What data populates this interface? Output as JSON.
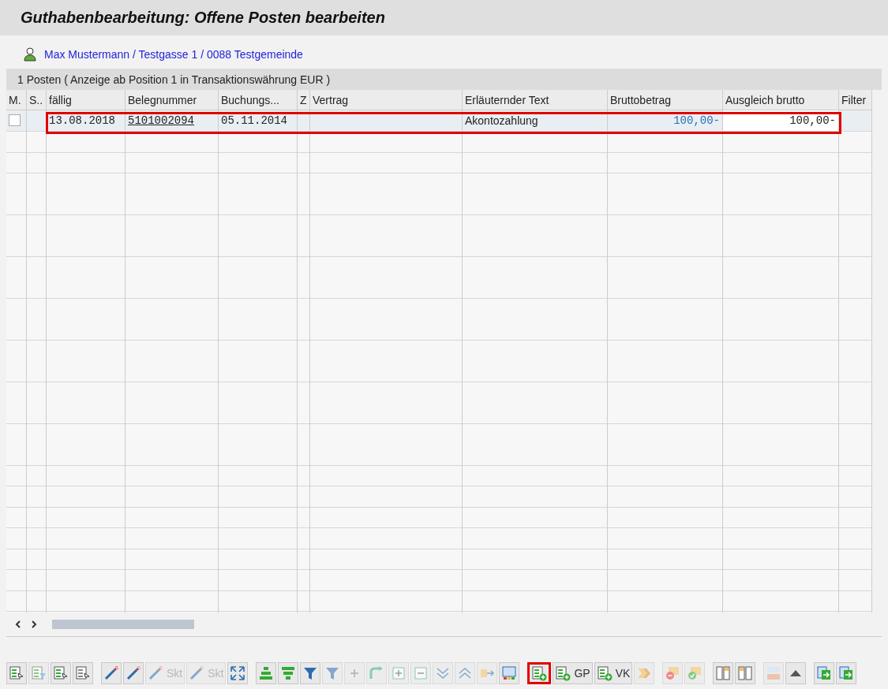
{
  "window": {
    "title": "Guthabenbearbeitung: Offene Posten bearbeiten"
  },
  "partner": {
    "text": "Max Mustermann / Testgasse 1 / 0088 Testgemeinde"
  },
  "info_bar": "1 Posten ( Anzeige ab Position 1 in Transaktionswährung EUR )",
  "table": {
    "columns": [
      "M.",
      "S..",
      "fällig",
      "Belegnummer",
      "Buchungs...",
      "Z",
      "Vertrag",
      "Erläuternder Text",
      "Bruttobetrag",
      "Ausgleich brutto",
      "Filter"
    ],
    "rows": [
      {
        "checked": false,
        "highlighted": true,
        "faellig": "13.08.2018",
        "belegnummer": "5101002094",
        "buchung": "05.11.2014",
        "text": "Akontozahlung",
        "brutto": "100,00-",
        "ausgleich": "100,00-"
      }
    ]
  },
  "toolbar": [
    {
      "group": [
        {
          "kind": "select",
          "disabled": false,
          "highlighted": false
        },
        {
          "kind": "listfilter",
          "disabled": true,
          "highlighted": false
        },
        {
          "kind": "select",
          "disabled": false,
          "highlighted": false
        },
        {
          "kind": "plain",
          "disabled": false,
          "highlighted": false
        }
      ]
    },
    {
      "group": [
        {
          "kind": "wand",
          "disabled": false,
          "highlighted": false
        },
        {
          "kind": "wanddark",
          "disabled": false,
          "highlighted": false
        },
        {
          "kind": "wand",
          "label": "Skt",
          "disabled": true,
          "highlighted": false
        },
        {
          "kind": "wanddark",
          "label": "Skt",
          "disabled": true,
          "highlighted": false
        },
        {
          "kind": "expand",
          "disabled": false,
          "highlighted": false
        }
      ]
    },
    {
      "group": [
        {
          "kind": "sum",
          "disabled": false,
          "highlighted": false
        },
        {
          "kind": "subtotal",
          "disabled": false,
          "highlighted": false
        },
        {
          "kind": "filter",
          "disabled": false,
          "highlighted": false
        },
        {
          "kind": "filter",
          "disabled": true,
          "highlighted": false
        },
        {
          "kind": "plus",
          "disabled": true,
          "highlighted": false
        },
        {
          "kind": "tree",
          "disabled": true,
          "highlighted": false
        },
        {
          "kind": "expandnode",
          "disabled": true,
          "highlighted": false
        },
        {
          "kind": "collapsenode",
          "disabled": true,
          "highlighted": false
        },
        {
          "kind": "down",
          "disabled": true,
          "highlighted": false
        },
        {
          "kind": "up",
          "disabled": true,
          "highlighted": false
        },
        {
          "kind": "export",
          "disabled": true,
          "highlighted": false
        },
        {
          "kind": "layout",
          "disabled": false,
          "highlighted": false
        }
      ]
    },
    {
      "group": [
        {
          "kind": "addrow",
          "disabled": false,
          "highlighted": true
        },
        {
          "kind": "addrow",
          "label": "GP",
          "disabled": false,
          "highlighted": false
        },
        {
          "kind": "addrow",
          "label": "VK",
          "disabled": false,
          "highlighted": false
        },
        {
          "kind": "swap",
          "disabled": true,
          "highlighted": false
        }
      ]
    },
    {
      "group": [
        {
          "kind": "remove",
          "disabled": true,
          "highlighted": false
        },
        {
          "kind": "confirm",
          "disabled": true,
          "highlighted": false
        }
      ]
    },
    {
      "group": [
        {
          "kind": "colleft",
          "disabled": false,
          "highlighted": false
        },
        {
          "kind": "colright",
          "disabled": false,
          "highlighted": false
        }
      ]
    },
    {
      "group": [
        {
          "kind": "currency",
          "disabled": true,
          "highlighted": false
        },
        {
          "kind": "triangle",
          "disabled": false,
          "highlighted": false
        }
      ]
    },
    {
      "group": [
        {
          "kind": "transfer",
          "disabled": false,
          "highlighted": false
        },
        {
          "kind": "transfer",
          "disabled": false,
          "highlighted": false
        }
      ]
    }
  ]
}
